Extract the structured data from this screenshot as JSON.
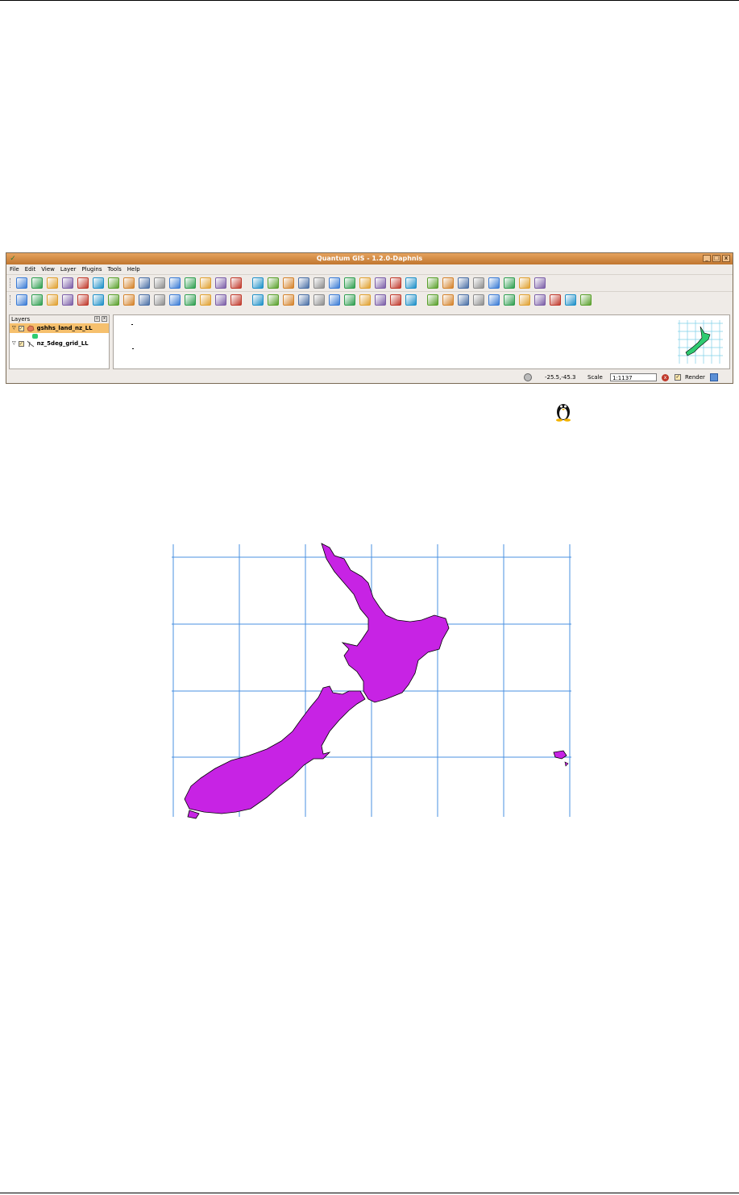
{
  "window": {
    "title": "Quantum GIS - 1.2.0-Daphnis",
    "controls": [
      "_",
      "□",
      "x"
    ]
  },
  "menu": [
    "File",
    "Edit",
    "View",
    "Layer",
    "Plugins",
    "Tools",
    "Help"
  ],
  "layers_panel": {
    "title": "Layers",
    "layers": [
      {
        "name": "gshhs_land_nz_LL",
        "checked": true,
        "selected": true,
        "symbol_color": "#2ecc71"
      },
      {
        "name": "nz_5deg_grid_LL",
        "checked": true,
        "selected": false
      }
    ]
  },
  "status": {
    "coordinates": "-25.5,-45.3",
    "scale_label": "Scale",
    "scale_value": "1:1137",
    "render_label": "Render",
    "render_checked": true
  },
  "colors": {
    "land_fill": "#c723e4",
    "grid_line": "#4a90e2",
    "overview_land": "#2ecc71",
    "overview_grid": "#7fd0e8",
    "titlebar": "#d08a45",
    "selected_layer": "#f6c06d"
  },
  "icons": {
    "os_badge": "tux-penguin-icon",
    "toolbar1": [
      "new-project-icon",
      "open-project-icon",
      "save-project-icon",
      "save-as-icon",
      "print-icon",
      "add-vector-icon",
      "add-raster-icon",
      "add-postgis-icon",
      "add-spatialite-icon",
      "add-wms-icon",
      "add-wfs-icon",
      "remove-layer-icon",
      "new-vector-icon",
      "layer-properties-icon",
      "show-all-icon",
      "hide-all-icon",
      "zoom-in-icon",
      "pan-icon",
      "zoom-in-icon",
      "zoom-out-icon",
      "zoom-full-icon",
      "zoom-selection-icon",
      "zoom-layer-icon",
      "zoom-last-icon",
      "zoom-actual-icon",
      "refresh-icon",
      "identify-icon",
      "select-icon",
      "attribute-table-icon",
      "measure-icon",
      "measure-area-icon",
      "map-tips-icon",
      "bookmark-icon",
      "show-bookmarks-icon"
    ],
    "toolbar2": [
      "toggle-edit-icon",
      "move-feature-icon",
      "pan-edit-icon",
      "node-tool-icon",
      "delete-node-icon",
      "delete-selected-icon",
      "cut-icon",
      "copy-icon",
      "paste-icon",
      "copyright-icon",
      "north-arrow-icon",
      "scale-bar-icon",
      "gps-icon",
      "georeferencer-icon",
      "grass-icon",
      "graticule-icon",
      "histogram-icon",
      "compass-icon",
      "dxf-icon",
      "pdf-icon",
      "line-icon",
      "bus-icon",
      "import-icon",
      "plugin-icon",
      "spatial-query-icon",
      "edit-icon",
      "digitize-icon",
      "undo-icon",
      "redo-icon",
      "split-icon",
      "merge-icon",
      "rotate-icon",
      "add-ring-icon",
      "add-island-icon",
      "reshape-icon",
      "simplify-icon",
      "offset-icon"
    ]
  }
}
